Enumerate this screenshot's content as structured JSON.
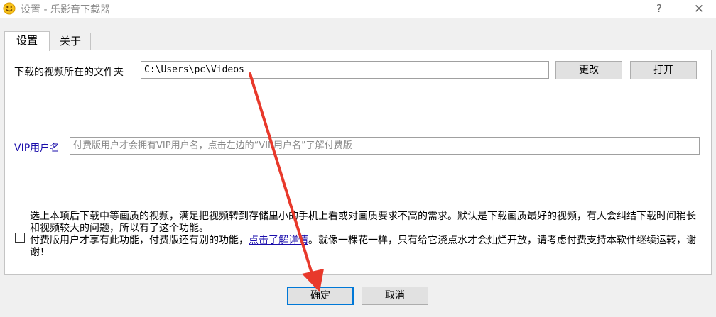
{
  "window": {
    "title": "设置 - 乐影音下载器",
    "help_label": "?",
    "close_label": "✕",
    "icon": "smiley-icon"
  },
  "tabs": [
    {
      "label": "设置",
      "active": true
    },
    {
      "label": "关于",
      "active": false
    }
  ],
  "settings": {
    "folder_label": "下载的视频所在的文件夹",
    "folder_value": "C:\\Users\\pc\\Videos",
    "change_button": "更改",
    "open_button": "打开",
    "vip_label": "VIP用户名",
    "vip_placeholder": "付费版用户才会拥有VIP用户名，点击左边的“VIP用户名”了解付费版",
    "checkbox_checked": false,
    "notice_line1": "选上本项后下载中等画质的视频，满足把视频转到存储里小的手机上看或对画质要求不高的需求。默认是下载画质最好的视频，有人会纠结下载时间稍长和视频较大的问题，所以有了这个功能。",
    "notice_line2_before": "付费版用户才享有此功能，付费版还有别的功能，",
    "notice_link": "点击了解详情",
    "notice_line2_after": "。就像一棵花一样，只有给它浇点水才会灿烂开放，请考虑付费支持本软件继续运转，谢谢！"
  },
  "footer": {
    "ok_button": "确定",
    "cancel_button": "取消"
  },
  "annotation": {
    "arrow_color": "#e8392b"
  }
}
